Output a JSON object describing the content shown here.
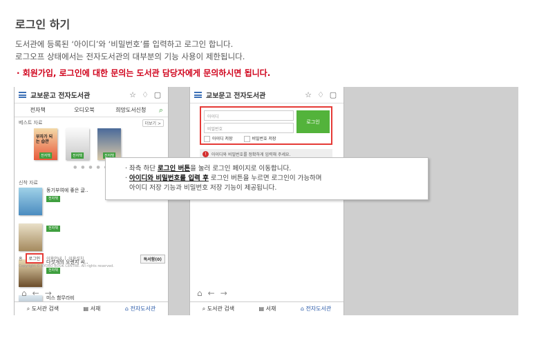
{
  "title": "로그인 하기",
  "desc": {
    "line1": "도서관에 등록된 ‘아이디’와 ‘비밀번호’를 입력하고 로그인 합니다.",
    "line2": "로그오프 상태에서는 전자도서관의 대부분의 기능 사용이 제한됩니다."
  },
  "notice": "· 회원가입, 로그인에 대한 문의는 도서관 담당자에게 문의하시면 됩니다.",
  "header": {
    "title": "교보문고 전자도서관"
  },
  "tabs": [
    "전자책",
    "오디오북",
    "희망도서신청"
  ],
  "bestseller": {
    "label": "베스트 자료",
    "more": "더보기 >"
  },
  "book_badge": "전자책",
  "book_titles": {
    "b1": "부자가 되는 습관"
  },
  "newbooks": {
    "label": "신착 자료",
    "items": [
      {
        "title": "동기부여에 좋은 글.."
      },
      {
        "title": ""
      },
      {
        "title": "다섯개의 오렌지 씨.."
      },
      {
        "title": "미스 함무라비"
      }
    ]
  },
  "footer": {
    "home": "홈",
    "login": "로그인",
    "guide": "이용안내",
    "app": "이용설치",
    "mobile": "독서함(0)",
    "copyright": "Copyright © KYOBO BOOK CENTRE. All rights reserved."
  },
  "bottom_bar": {
    "search": "도서관 검색",
    "shelf": "서재",
    "library": "전자도서관"
  },
  "login_form": {
    "id_placeholder": "아이디",
    "pw_placeholder": "비밀번호",
    "button": "로그인",
    "save_id": "아이디 저장",
    "save_pw": "비밀번호 저장",
    "warning": "아이디와 비밀번호를 정확하게 입력해 주세요."
  },
  "tooltip": {
    "l1_pre": "· 좌측 하단 ",
    "l1_bold": "로그인 버튼",
    "l1_post": "을 눌러 로그인 페이지로 이동합니다.",
    "l2_pre": "· ",
    "l2_bold": "아이디와 비밀번호를 입력 후",
    "l2_post": " 로그인 버튼을 누르면 로그인이 가능하며",
    "l3": "아이디 저장 기능과 비밀번호 저장 기능이 제공됩니다."
  }
}
